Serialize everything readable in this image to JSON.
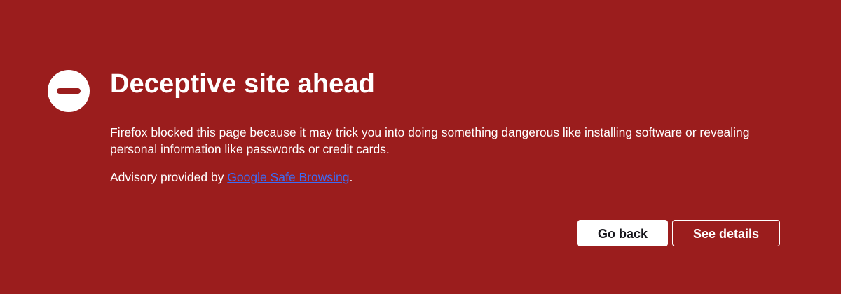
{
  "page": {
    "title": "Deceptive site ahead",
    "description": "Firefox blocked this page because it may trick you into doing something dangerous like installing software or revealing personal information like passwords or credit cards.",
    "advisory": {
      "prefix": "Advisory provided by ",
      "link_text": "Google Safe Browsing",
      "suffix": "."
    },
    "icon": "blocked-minus-circle-icon"
  },
  "buttons": {
    "go_back": "Go back",
    "see_details": "See details"
  },
  "colors": {
    "background": "#9b1d1d",
    "text": "#ffffff",
    "link": "#3b6cf6",
    "primary_button_bg": "#ffffff",
    "primary_button_text": "#15141a"
  }
}
